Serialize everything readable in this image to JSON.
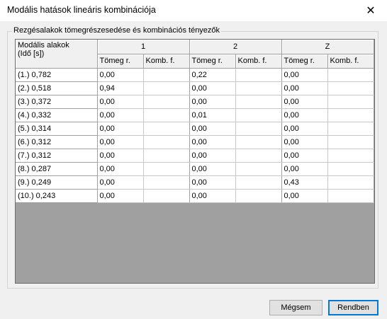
{
  "window": {
    "title": "Modális hatások lineáris kombinációja",
    "close_icon": "close-icon"
  },
  "group": {
    "legend": "Rezgésalakok tömegrészesedése és kombinációs tényezők"
  },
  "table": {
    "corner_label_line1": "Modális alakok",
    "corner_label_line2": "(Idő [s])",
    "groups": [
      "1",
      "2",
      "Z"
    ],
    "subheaders": [
      "Tömeg r.",
      "Komb. f.",
      "Tömeg r.",
      "Komb. f.",
      "Tömeg r.",
      "Komb. f."
    ],
    "rows": [
      {
        "label": "(1.) 0,782",
        "values": [
          "0,00",
          "",
          "0,22",
          "",
          "0,00",
          ""
        ]
      },
      {
        "label": "(2.) 0,518",
        "values": [
          "0,94",
          "",
          "0,00",
          "",
          "0,00",
          ""
        ]
      },
      {
        "label": "(3.) 0,372",
        "values": [
          "0,00",
          "",
          "0,00",
          "",
          "0,00",
          ""
        ]
      },
      {
        "label": "(4.) 0,332",
        "values": [
          "0,00",
          "",
          "0,01",
          "",
          "0,00",
          ""
        ]
      },
      {
        "label": "(5.) 0,314",
        "values": [
          "0,00",
          "",
          "0,00",
          "",
          "0,00",
          ""
        ]
      },
      {
        "label": "(6.) 0,312",
        "values": [
          "0,00",
          "",
          "0,00",
          "",
          "0,00",
          ""
        ]
      },
      {
        "label": "(7.) 0,312",
        "values": [
          "0,00",
          "",
          "0,00",
          "",
          "0,00",
          ""
        ]
      },
      {
        "label": "(8.) 0,287",
        "values": [
          "0,00",
          "",
          "0,00",
          "",
          "0,00",
          ""
        ]
      },
      {
        "label": "(9.) 0,249",
        "values": [
          "0,00",
          "",
          "0,00",
          "",
          "0,43",
          ""
        ]
      },
      {
        "label": "(10.) 0,243",
        "values": [
          "0,00",
          "",
          "0,00",
          "",
          "0,00",
          ""
        ]
      }
    ]
  },
  "buttons": {
    "cancel": "Mégsem",
    "ok": "Rendben"
  }
}
